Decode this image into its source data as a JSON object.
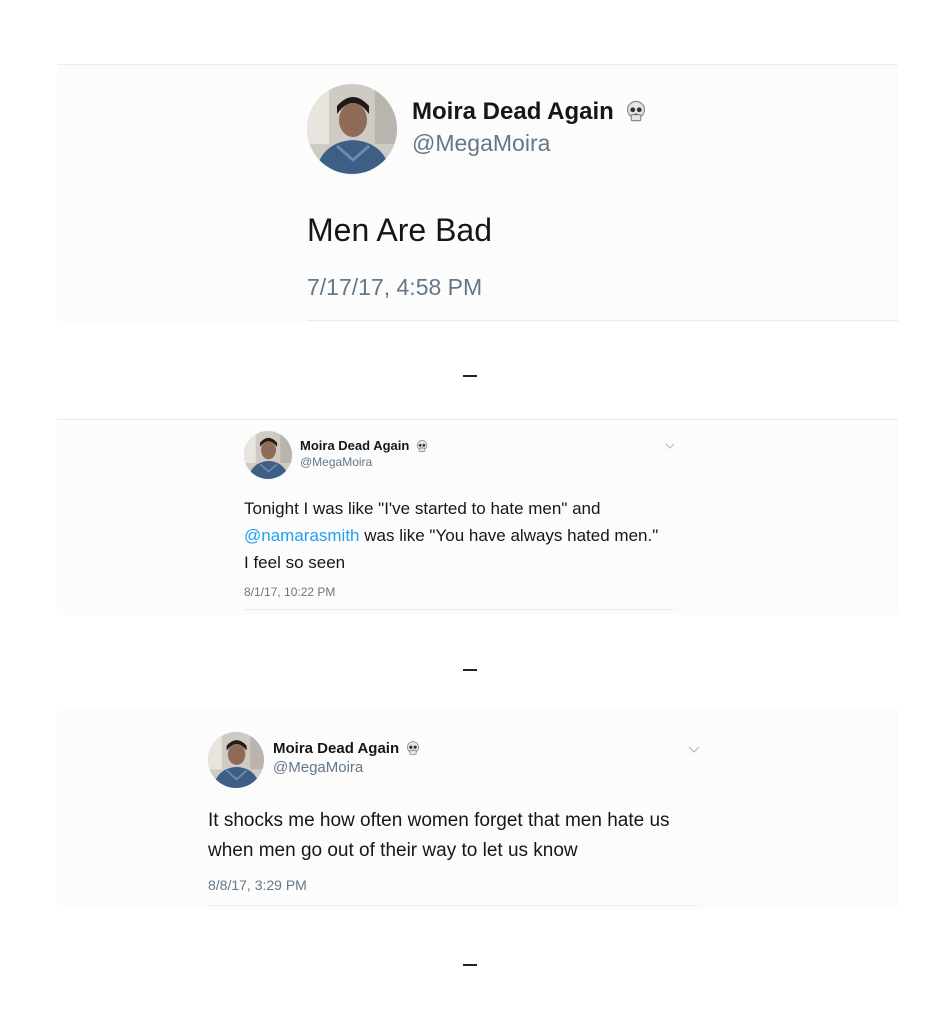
{
  "tweets": [
    {
      "display_name": "Moira Dead Again",
      "handle": "@MegaMoira",
      "text_lines": [
        "Men Are Bad"
      ],
      "timestamp": "7/17/17, 4:58 PM"
    },
    {
      "display_name": "Moira Dead Again",
      "handle": "@MegaMoira",
      "line1": "Tonight I was like \"I've started to hate men\" and",
      "mention": "@namarasmith",
      "line2_rest": " was like \"You have always hated men.\"",
      "line3": "I feel so seen",
      "timestamp": "8/1/17, 10:22 PM"
    },
    {
      "display_name": "Moira Dead Again",
      "handle": "@MegaMoira",
      "line1": "It shocks me how often women forget that men hate us",
      "line2": "when men go out of their way to let us know",
      "timestamp": "8/8/17, 3:29 PM"
    }
  ],
  "separator": "–",
  "icons": {
    "name_badge": "skull-icon",
    "menu": "chevron-down-icon"
  },
  "colors": {
    "mention": "#1da1f2",
    "secondary_text": "#657786",
    "card_background": "#fcfcfc"
  }
}
